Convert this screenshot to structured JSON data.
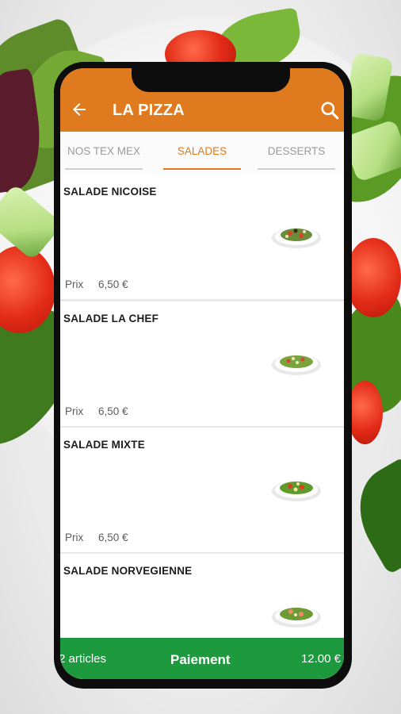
{
  "app": {
    "title": "LA PIZZA"
  },
  "tabs": [
    {
      "label": "NOS TEX MEX",
      "active": false
    },
    {
      "label": "SALADES",
      "active": true
    },
    {
      "label": "DESSERTS",
      "active": false
    }
  ],
  "items": [
    {
      "name": "SALADE NICOISE",
      "price_label": "Prix",
      "price": "6,50 €"
    },
    {
      "name": "SALADE LA CHEF",
      "price_label": "Prix",
      "price": "6,50 €"
    },
    {
      "name": "SALADE MIXTE",
      "price_label": "Prix",
      "price": "6,50 €"
    },
    {
      "name": "SALADE NORVEGIENNE"
    }
  ],
  "cart": {
    "count_label": "2 articles",
    "checkout_label": "Paiement",
    "total": "12.00 €"
  },
  "colors": {
    "accent": "#e07a1f",
    "cart": "#1e9a3e"
  },
  "icons": [
    "back-arrow-icon",
    "search-icon",
    "salad-dish-icon"
  ]
}
